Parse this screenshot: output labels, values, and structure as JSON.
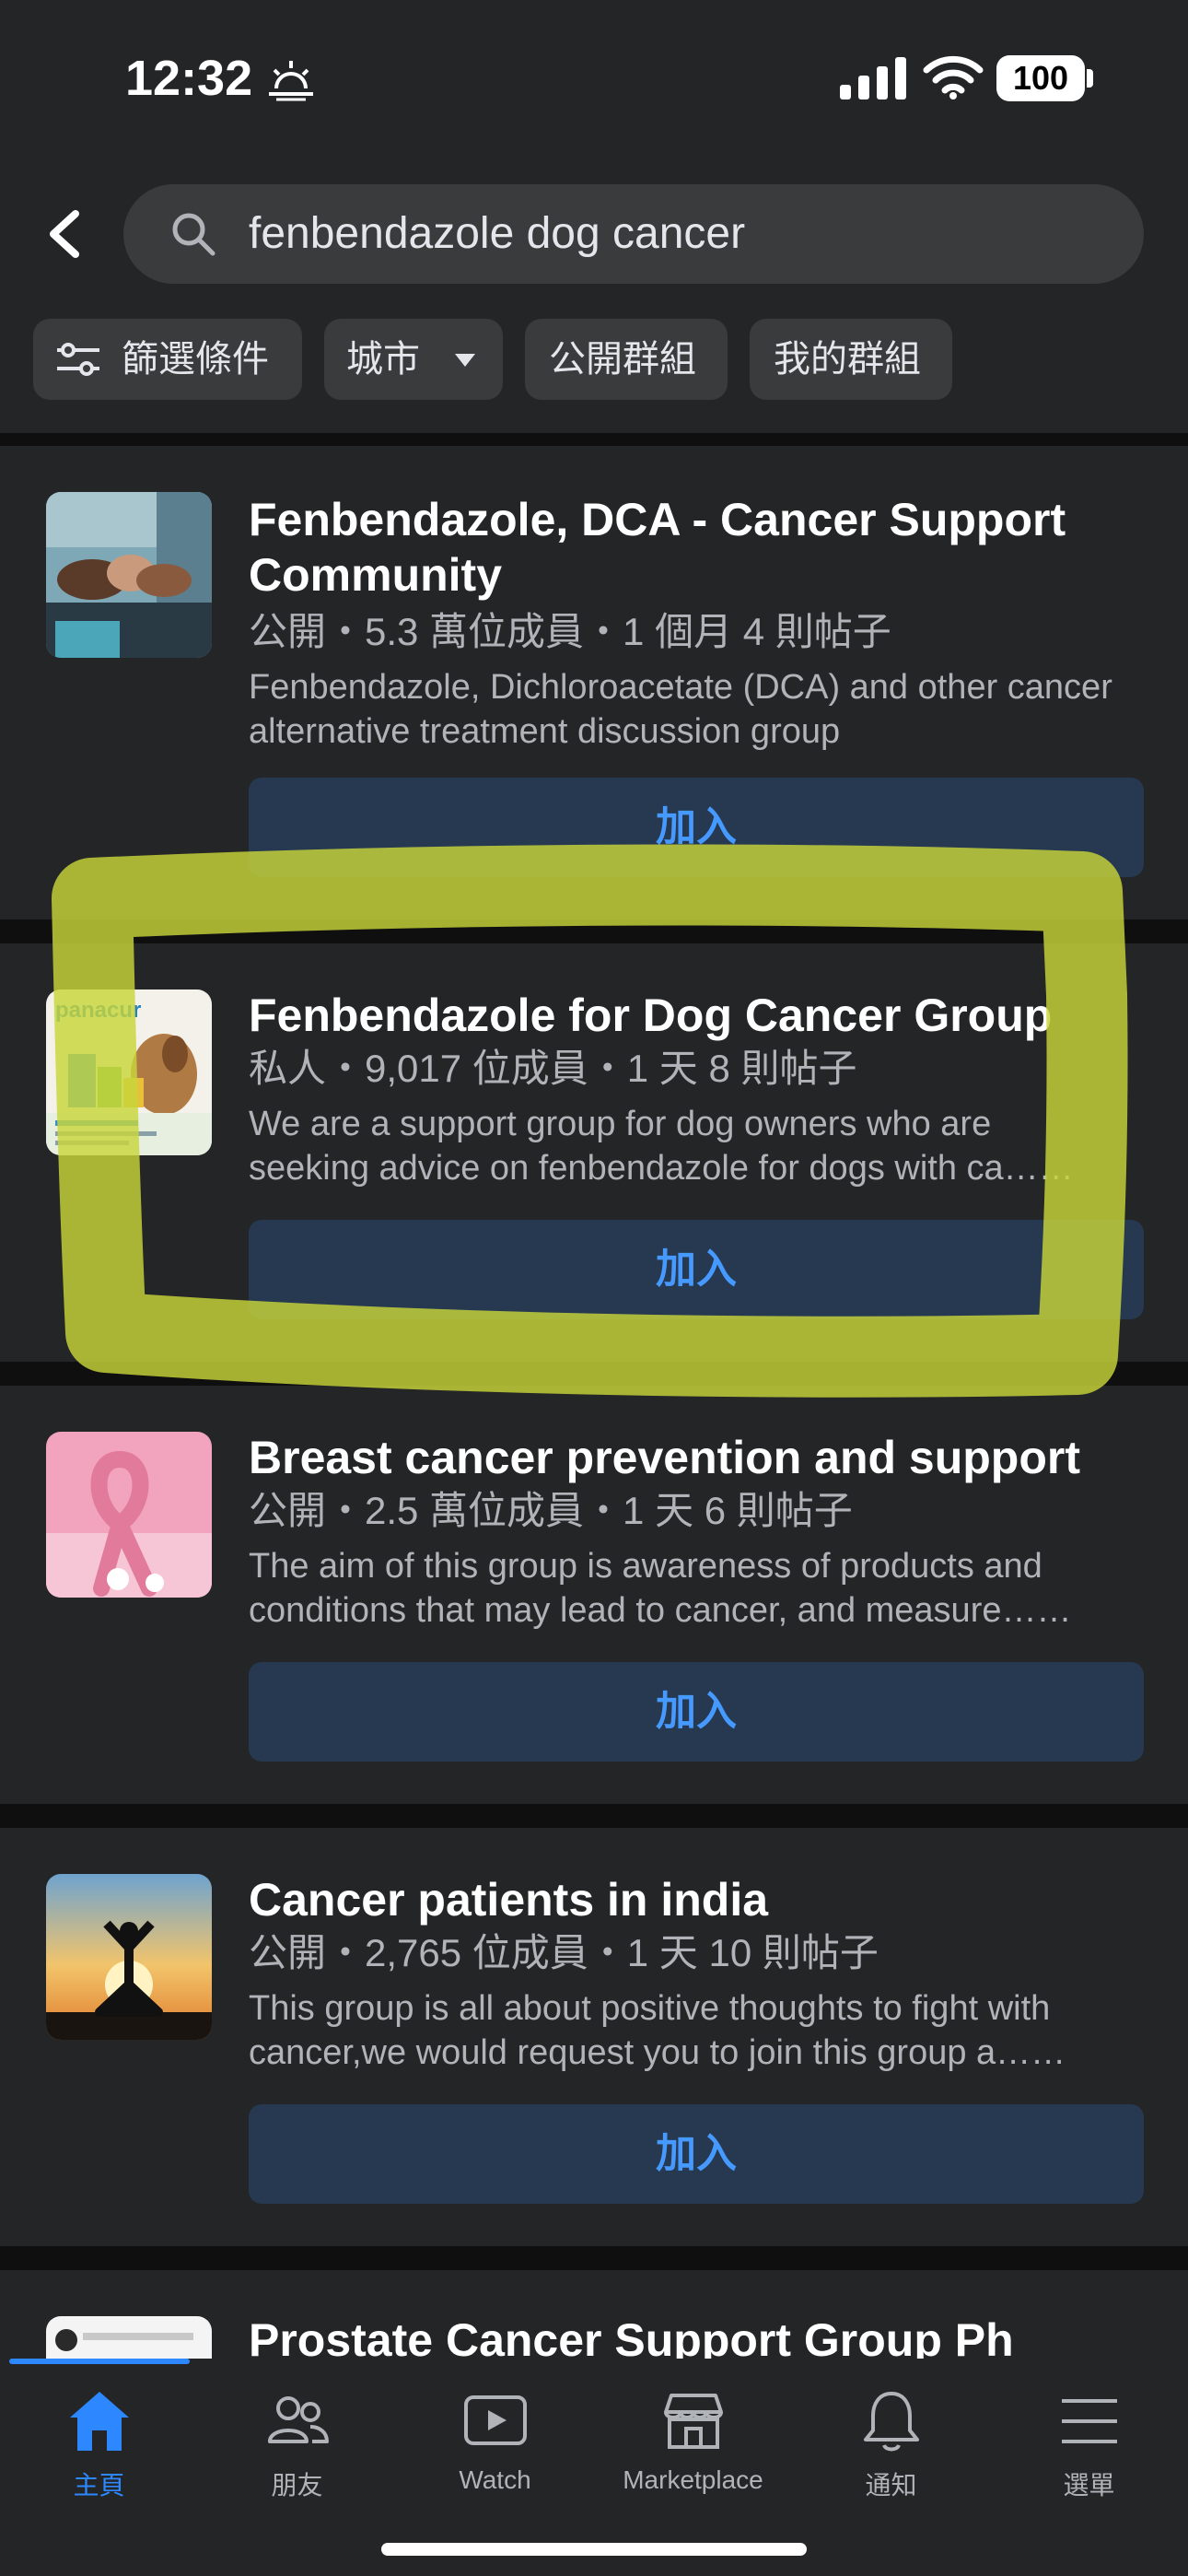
{
  "status_bar": {
    "time": "12:32",
    "battery": "100"
  },
  "search": {
    "query": "fenbendazole dog cancer"
  },
  "filters": [
    {
      "label": "篩選條件"
    },
    {
      "label": "城市"
    },
    {
      "label": "公開群組"
    },
    {
      "label": "我的群組"
    }
  ],
  "groups": [
    {
      "title": "Fenbendazole, DCA - Cancer Support Community",
      "meta": "公開・5.3 萬位成員・1 個月 4 則帖子",
      "description": "Fenbendazole, Dichloroacetate (DCA) and other cancer alternative treatment discussion group",
      "join_label": "加入"
    },
    {
      "title": "Fenbendazole for Dog Cancer Group",
      "meta": "私人・9,017 位成員・1 天 8 則帖子",
      "description_line1": "We are a support group for dog owners who are",
      "description_line2": "seeking advice on fenbendazole for dogs with ca……",
      "thumbnail_logo": "panacur",
      "join_label": "加入"
    },
    {
      "title": "Breast cancer prevention and support",
      "meta": "公開・2.5 萬位成員・1 天 6 則帖子",
      "description_line1": "The aim of this group is awareness of products and",
      "description_line2": "conditions that may lead to cancer, and measure……",
      "join_label": "加入"
    },
    {
      "title": "Cancer patients in india",
      "meta": "公開・2,765 位成員・1 天 10 則帖子",
      "description_line1": "This group is all about positive thoughts to fight with",
      "description_line2": "cancer,we would request you to join this group a……",
      "join_label": "加入"
    },
    {
      "title": "Prostate Cancer Support Group Ph"
    }
  ],
  "tabbar": {
    "items": [
      {
        "label": "主頁",
        "icon": "home-icon",
        "active": true
      },
      {
        "label": "朋友",
        "icon": "friends-icon"
      },
      {
        "label": "Watch",
        "icon": "watch-icon"
      },
      {
        "label": "Marketplace",
        "icon": "marketplace-icon"
      },
      {
        "label": "通知",
        "icon": "bell-icon"
      },
      {
        "label": "選單",
        "icon": "menu-icon"
      }
    ]
  },
  "colors": {
    "background": "#18191a",
    "surface": "#242526",
    "join_button_bg": "#263951",
    "join_button_text": "#4599ff",
    "active_tab": "#2d88ff",
    "annotation_highlight": "#c8d63a"
  }
}
